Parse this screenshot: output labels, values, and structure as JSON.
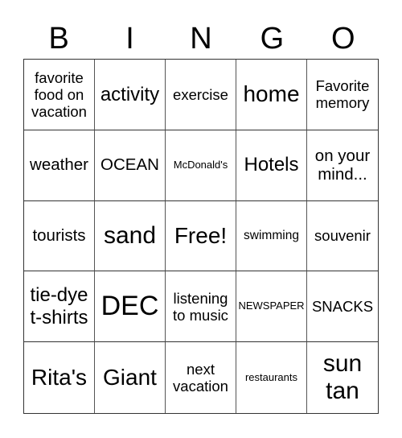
{
  "header": {
    "letters": [
      "B",
      "I",
      "N",
      "G",
      "O"
    ]
  },
  "rows": [
    [
      "favorite food on vacation",
      "activity",
      "exercise",
      "home",
      "Favorite memory"
    ],
    [
      "weather",
      "OCEAN",
      "McDonald's",
      "Hotels",
      "on your mind..."
    ],
    [
      "tourists",
      "sand",
      "Free!",
      "swimming",
      "souvenir"
    ],
    [
      "tie-dye t-shirts",
      "DEC",
      "listening to music",
      "NEWSPAPER",
      "SNACKS"
    ],
    [
      "Rita's",
      "Giant",
      "next vacation",
      "restaurants",
      "sun tan"
    ]
  ]
}
